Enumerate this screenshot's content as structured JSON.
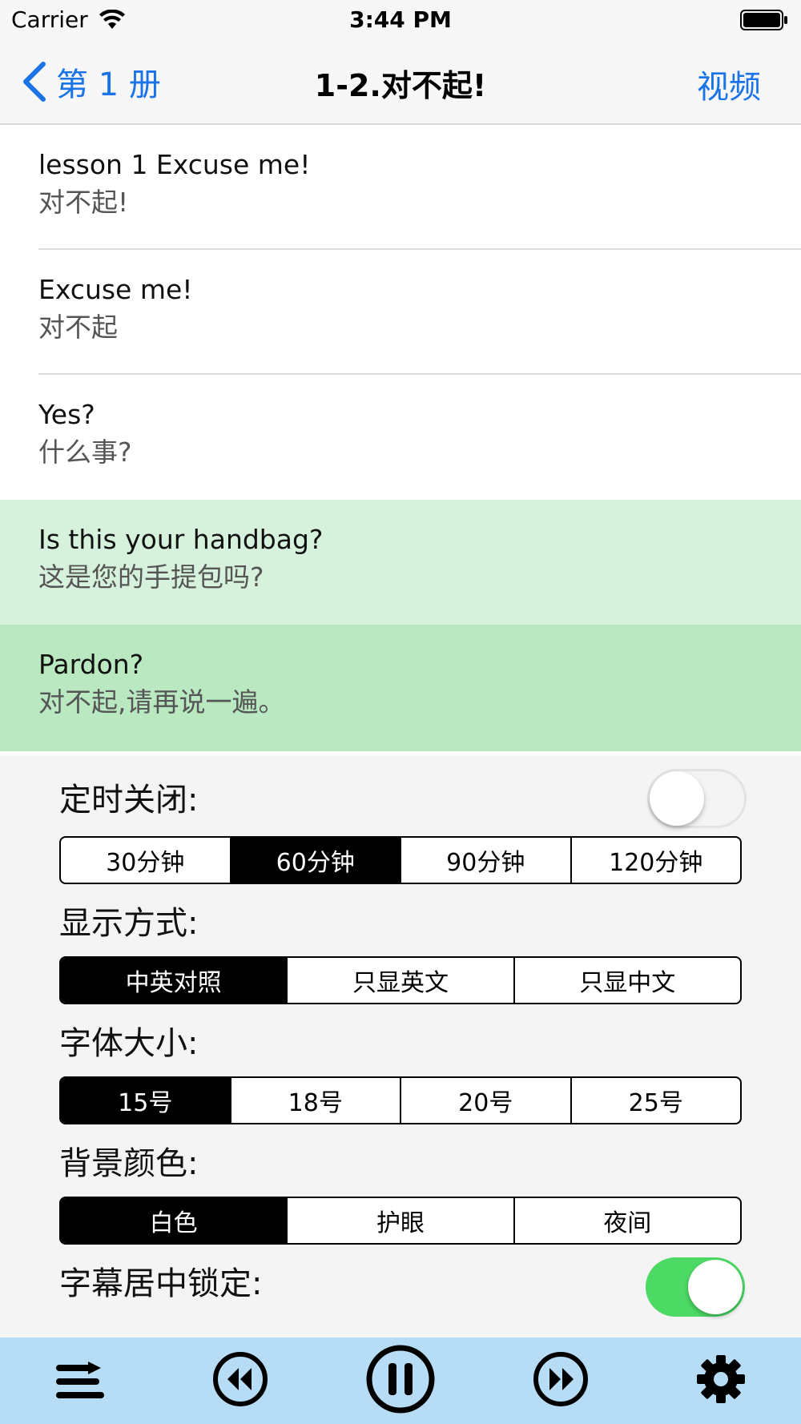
{
  "status_bar": {
    "carrier": "Carrier",
    "time": "3:44 PM",
    "wifi_icon": "wifi-icon",
    "battery_icon": "battery-icon"
  },
  "nav": {
    "back_label": "第 1 册",
    "title": "1-2.对不起!",
    "right_label": "视频",
    "accent_color": "#1a74e8"
  },
  "lines": [
    {
      "en": "lesson 1 Excuse me!",
      "zh": "对不起!",
      "highlight": "none"
    },
    {
      "en": "Excuse me!",
      "zh": "对不起",
      "highlight": "none"
    },
    {
      "en": "Yes?",
      "zh": "什么事?",
      "highlight": "none"
    },
    {
      "en": "Is this your handbag?",
      "zh": "这是您的手提包吗?",
      "highlight": "light",
      "color": "#d7f2dc"
    },
    {
      "en": "Pardon?",
      "zh": "对不起,请再说一遍。",
      "highlight": "current",
      "color": "#b9e8c1"
    }
  ],
  "settings": {
    "timer": {
      "label": "定时关闭:",
      "toggle_on": false,
      "options": [
        "30分钟",
        "60分钟",
        "90分钟",
        "120分钟"
      ],
      "selected": "60分钟"
    },
    "display_mode": {
      "label": "显示方式:",
      "options": [
        "中英对照",
        "只显英文",
        "只显中文"
      ],
      "selected": "中英对照"
    },
    "font_size": {
      "label": "字体大小:",
      "options": [
        "15号",
        "18号",
        "20号",
        "25号"
      ],
      "selected": "15号"
    },
    "background_color": {
      "label": "背景颜色:",
      "options": [
        "白色",
        "护眼",
        "夜间"
      ],
      "selected": "白色"
    },
    "subtitle_lock": {
      "label": "字幕居中锁定:",
      "toggle_on": true,
      "on_color": "#4cd964"
    }
  },
  "toolbar": {
    "background_color": "#b7dcf5",
    "icons": [
      "playlist-icon",
      "previous-icon",
      "pause-icon",
      "next-icon",
      "settings-gear-icon"
    ]
  }
}
